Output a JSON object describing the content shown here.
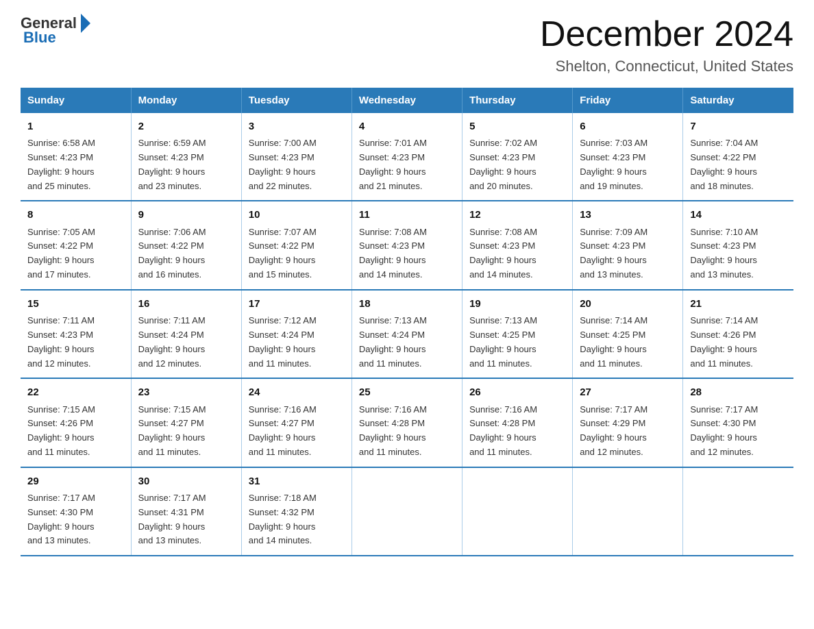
{
  "logo": {
    "general": "General",
    "blue": "Blue"
  },
  "title": "December 2024",
  "subtitle": "Shelton, Connecticut, United States",
  "header_days": [
    "Sunday",
    "Monday",
    "Tuesday",
    "Wednesday",
    "Thursday",
    "Friday",
    "Saturday"
  ],
  "weeks": [
    [
      {
        "day": "1",
        "sunrise": "6:58 AM",
        "sunset": "4:23 PM",
        "daylight": "9 hours and 25 minutes."
      },
      {
        "day": "2",
        "sunrise": "6:59 AM",
        "sunset": "4:23 PM",
        "daylight": "9 hours and 23 minutes."
      },
      {
        "day": "3",
        "sunrise": "7:00 AM",
        "sunset": "4:23 PM",
        "daylight": "9 hours and 22 minutes."
      },
      {
        "day": "4",
        "sunrise": "7:01 AM",
        "sunset": "4:23 PM",
        "daylight": "9 hours and 21 minutes."
      },
      {
        "day": "5",
        "sunrise": "7:02 AM",
        "sunset": "4:23 PM",
        "daylight": "9 hours and 20 minutes."
      },
      {
        "day": "6",
        "sunrise": "7:03 AM",
        "sunset": "4:23 PM",
        "daylight": "9 hours and 19 minutes."
      },
      {
        "day": "7",
        "sunrise": "7:04 AM",
        "sunset": "4:22 PM",
        "daylight": "9 hours and 18 minutes."
      }
    ],
    [
      {
        "day": "8",
        "sunrise": "7:05 AM",
        "sunset": "4:22 PM",
        "daylight": "9 hours and 17 minutes."
      },
      {
        "day": "9",
        "sunrise": "7:06 AM",
        "sunset": "4:22 PM",
        "daylight": "9 hours and 16 minutes."
      },
      {
        "day": "10",
        "sunrise": "7:07 AM",
        "sunset": "4:22 PM",
        "daylight": "9 hours and 15 minutes."
      },
      {
        "day": "11",
        "sunrise": "7:08 AM",
        "sunset": "4:23 PM",
        "daylight": "9 hours and 14 minutes."
      },
      {
        "day": "12",
        "sunrise": "7:08 AM",
        "sunset": "4:23 PM",
        "daylight": "9 hours and 14 minutes."
      },
      {
        "day": "13",
        "sunrise": "7:09 AM",
        "sunset": "4:23 PM",
        "daylight": "9 hours and 13 minutes."
      },
      {
        "day": "14",
        "sunrise": "7:10 AM",
        "sunset": "4:23 PM",
        "daylight": "9 hours and 13 minutes."
      }
    ],
    [
      {
        "day": "15",
        "sunrise": "7:11 AM",
        "sunset": "4:23 PM",
        "daylight": "9 hours and 12 minutes."
      },
      {
        "day": "16",
        "sunrise": "7:11 AM",
        "sunset": "4:24 PM",
        "daylight": "9 hours and 12 minutes."
      },
      {
        "day": "17",
        "sunrise": "7:12 AM",
        "sunset": "4:24 PM",
        "daylight": "9 hours and 11 minutes."
      },
      {
        "day": "18",
        "sunrise": "7:13 AM",
        "sunset": "4:24 PM",
        "daylight": "9 hours and 11 minutes."
      },
      {
        "day": "19",
        "sunrise": "7:13 AM",
        "sunset": "4:25 PM",
        "daylight": "9 hours and 11 minutes."
      },
      {
        "day": "20",
        "sunrise": "7:14 AM",
        "sunset": "4:25 PM",
        "daylight": "9 hours and 11 minutes."
      },
      {
        "day": "21",
        "sunrise": "7:14 AM",
        "sunset": "4:26 PM",
        "daylight": "9 hours and 11 minutes."
      }
    ],
    [
      {
        "day": "22",
        "sunrise": "7:15 AM",
        "sunset": "4:26 PM",
        "daylight": "9 hours and 11 minutes."
      },
      {
        "day": "23",
        "sunrise": "7:15 AM",
        "sunset": "4:27 PM",
        "daylight": "9 hours and 11 minutes."
      },
      {
        "day": "24",
        "sunrise": "7:16 AM",
        "sunset": "4:27 PM",
        "daylight": "9 hours and 11 minutes."
      },
      {
        "day": "25",
        "sunrise": "7:16 AM",
        "sunset": "4:28 PM",
        "daylight": "9 hours and 11 minutes."
      },
      {
        "day": "26",
        "sunrise": "7:16 AM",
        "sunset": "4:28 PM",
        "daylight": "9 hours and 11 minutes."
      },
      {
        "day": "27",
        "sunrise": "7:17 AM",
        "sunset": "4:29 PM",
        "daylight": "9 hours and 12 minutes."
      },
      {
        "day": "28",
        "sunrise": "7:17 AM",
        "sunset": "4:30 PM",
        "daylight": "9 hours and 12 minutes."
      }
    ],
    [
      {
        "day": "29",
        "sunrise": "7:17 AM",
        "sunset": "4:30 PM",
        "daylight": "9 hours and 13 minutes."
      },
      {
        "day": "30",
        "sunrise": "7:17 AM",
        "sunset": "4:31 PM",
        "daylight": "9 hours and 13 minutes."
      },
      {
        "day": "31",
        "sunrise": "7:18 AM",
        "sunset": "4:32 PM",
        "daylight": "9 hours and 14 minutes."
      },
      null,
      null,
      null,
      null
    ]
  ],
  "labels": {
    "sunrise": "Sunrise:",
    "sunset": "Sunset:",
    "daylight": "Daylight:"
  }
}
